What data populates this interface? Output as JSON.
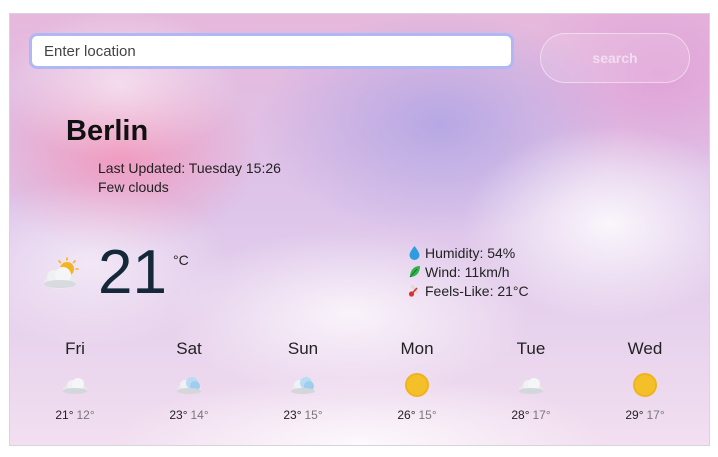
{
  "search": {
    "placeholder": "Enter location",
    "button_label": "search"
  },
  "current": {
    "city": "Berlin",
    "last_updated": "Last Updated: Tuesday 15:26",
    "description": "Few clouds",
    "temperature": "21",
    "unit": "°C",
    "icon": "few-clouds-icon",
    "humidity": "Humidity: 54%",
    "wind": "Wind: 11km/h",
    "feels_like": "Feels-Like: 21°C"
  },
  "forecast": [
    {
      "day": "Fri",
      "max": "21°",
      "min": "12°",
      "icon": "cloud-icon"
    },
    {
      "day": "Sat",
      "max": "23°",
      "min": "14°",
      "icon": "cloud-rain-icon"
    },
    {
      "day": "Sun",
      "max": "23°",
      "min": "15°",
      "icon": "cloud-rain-icon"
    },
    {
      "day": "Mon",
      "max": "26°",
      "min": "15°",
      "icon": "sun-icon"
    },
    {
      "day": "Tue",
      "max": "28°",
      "min": "17°",
      "icon": "cloud-icon"
    },
    {
      "day": "Wed",
      "max": "29°",
      "min": "17°",
      "icon": "sun-icon"
    }
  ],
  "colors": {
    "input_border": "#aeb8f2",
    "temperature_text": "#14283a",
    "sun": "#f0b31c"
  }
}
